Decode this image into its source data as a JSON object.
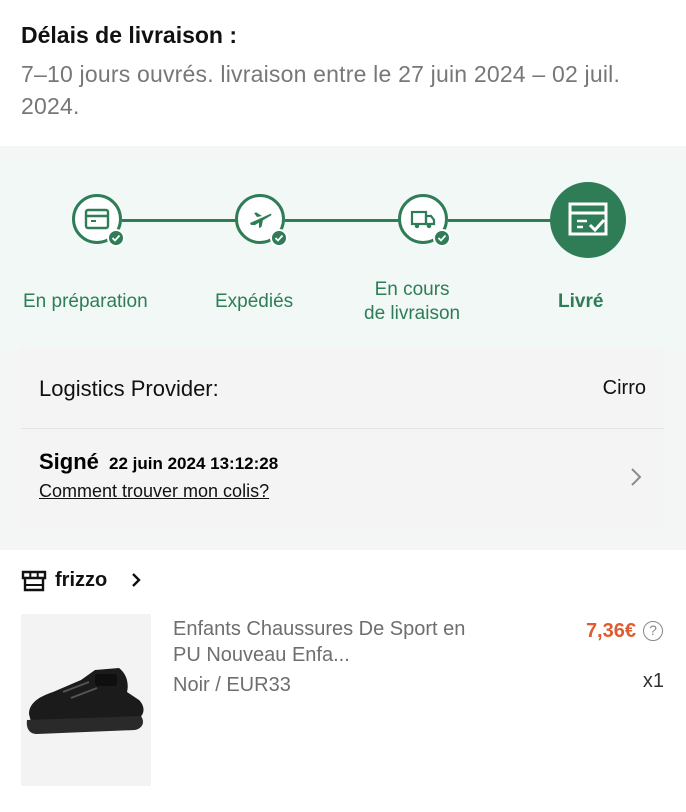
{
  "delivery": {
    "title": "Délais de livraison :",
    "text": "7–10 jours ouvrés. livraison entre le 27 juin 2024 – 02 juil. 2024."
  },
  "tracker": {
    "steps": [
      {
        "label": "En préparation",
        "icon": "package-icon",
        "done": true
      },
      {
        "label": "Expédiés",
        "icon": "airplane-icon",
        "done": true
      },
      {
        "label_line1": "En cours",
        "label_line2": "de livraison",
        "icon": "truck-icon",
        "done": true
      },
      {
        "label": "Livré",
        "icon": "delivered-box-icon",
        "current": true
      }
    ],
    "accent_color": "#2f7d57"
  },
  "logistics": {
    "provider_label": "Logistics Provider:",
    "provider_value": "Cirro",
    "status": "Signé",
    "status_time": "22 juin 2024 13:12:28",
    "help_link": "Comment trouver mon colis?"
  },
  "shop": {
    "name": "frizzo",
    "product": {
      "title": "Enfants Chaussures De Sport en PU Nouveau Enfa...",
      "variant": "Noir / EUR33",
      "price": "7,36€",
      "help": "?",
      "quantity": "x1",
      "price_color": "#e05c2e"
    }
  }
}
